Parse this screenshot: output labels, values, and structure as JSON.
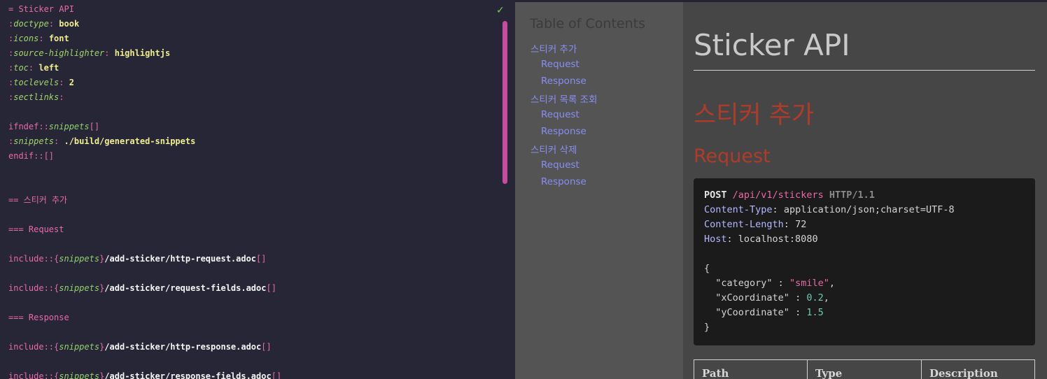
{
  "editor": {
    "title_line": "= Sticker API",
    "attributes": [
      {
        "name": "doctype",
        "value": "book"
      },
      {
        "name": "icons",
        "value": "font"
      },
      {
        "name": "source-highlighter",
        "value": "highlightjs"
      },
      {
        "name": "toc",
        "value": "left"
      },
      {
        "name": "toclevels",
        "value": "2"
      },
      {
        "name": "sectlinks",
        "value": ""
      }
    ],
    "ifndef_prefix": "ifndef::",
    "ifndef_attr": "snippets",
    "ifndef_suffix": "[]",
    "snippets_attr": "snippets",
    "snippets_value": "./build/generated-snippets",
    "endif": "endif::[]",
    "section_add": "== 스티커 추가",
    "sub_request": "=== Request",
    "sub_response": "=== Response",
    "include_keyword": "include::",
    "include_open": "{",
    "include_attr": "snippets",
    "include_close": "}",
    "include_brackets": "[]",
    "includes": [
      "/add-sticker/http-request.adoc",
      "/add-sticker/request-fields.adoc",
      "/add-sticker/http-response.adoc",
      "/add-sticker/response-fields.adoc"
    ],
    "status_icon": "check-icon"
  },
  "toc": {
    "title": "Table of Contents",
    "items": [
      {
        "label": "스티커 추가",
        "level": 1
      },
      {
        "label": "Request",
        "level": 2
      },
      {
        "label": "Response",
        "level": 2
      },
      {
        "label": "스티커 목록 조회",
        "level": 1
      },
      {
        "label": "Request",
        "level": 2
      },
      {
        "label": "Response",
        "level": 2
      },
      {
        "label": "스티커 삭제",
        "level": 1
      },
      {
        "label": "Request",
        "level": 2
      },
      {
        "label": "Response",
        "level": 2
      }
    ]
  },
  "content": {
    "title": "Sticker API",
    "section": "스티커 추가",
    "subsection": "Request",
    "http": {
      "method": "POST",
      "path": "/api/v1/stickers",
      "protocol": "HTTP/1.1",
      "headers": [
        {
          "key": "Content-Type",
          "value": "application/json;charset=UTF-8"
        },
        {
          "key": "Content-Length",
          "value": "72"
        },
        {
          "key": "Host",
          "value": "localhost:8080"
        }
      ],
      "open_brace": "{",
      "close_brace": "}",
      "body": [
        {
          "key": "\"category\"",
          "value": "\"smile\"",
          "kind": "str",
          "comma": ","
        },
        {
          "key": "\"xCoordinate\"",
          "value": "0.2",
          "kind": "num",
          "comma": ","
        },
        {
          "key": "\"yCoordinate\"",
          "value": "1.5",
          "kind": "num",
          "comma": ""
        }
      ]
    },
    "table_headers": [
      "Path",
      "Type",
      "Description"
    ]
  },
  "colors": {
    "editor_bg": "#262637",
    "accent_pink": "#e86aa8",
    "toc_link": "#8a8ef0",
    "heading_red": "#b03b2a"
  }
}
